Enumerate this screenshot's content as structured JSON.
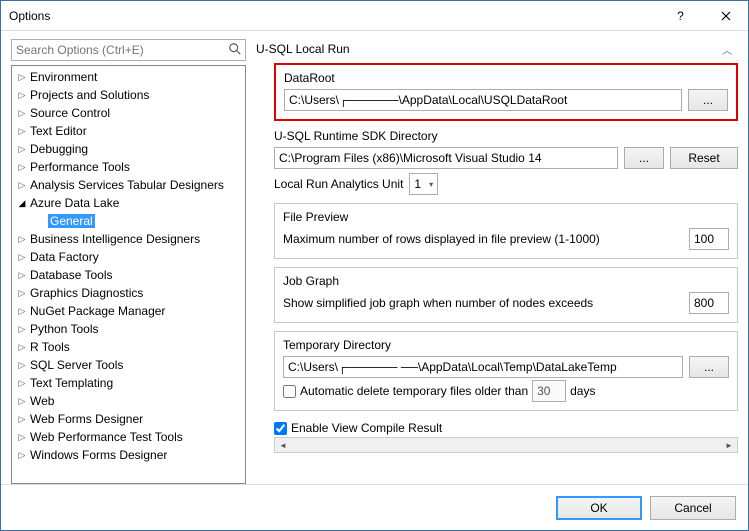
{
  "window": {
    "title": "Options"
  },
  "search": {
    "placeholder": "Search Options (Ctrl+E)"
  },
  "tree": {
    "items": [
      {
        "label": "Environment",
        "expanded": false,
        "indent": 0
      },
      {
        "label": "Projects and Solutions",
        "expanded": false,
        "indent": 0
      },
      {
        "label": "Source Control",
        "expanded": false,
        "indent": 0
      },
      {
        "label": "Text Editor",
        "expanded": false,
        "indent": 0
      },
      {
        "label": "Debugging",
        "expanded": false,
        "indent": 0
      },
      {
        "label": "Performance Tools",
        "expanded": false,
        "indent": 0
      },
      {
        "label": "Analysis Services Tabular Designers",
        "expanded": false,
        "indent": 0
      },
      {
        "label": "Azure Data Lake",
        "expanded": true,
        "indent": 0
      },
      {
        "label": "General",
        "expanded": null,
        "indent": 1,
        "selected": true
      },
      {
        "label": "Business Intelligence Designers",
        "expanded": false,
        "indent": 0
      },
      {
        "label": "Data Factory",
        "expanded": false,
        "indent": 0
      },
      {
        "label": "Database Tools",
        "expanded": false,
        "indent": 0
      },
      {
        "label": "Graphics Diagnostics",
        "expanded": false,
        "indent": 0
      },
      {
        "label": "NuGet Package Manager",
        "expanded": false,
        "indent": 0
      },
      {
        "label": "Python Tools",
        "expanded": false,
        "indent": 0
      },
      {
        "label": "R Tools",
        "expanded": false,
        "indent": 0
      },
      {
        "label": "SQL Server Tools",
        "expanded": false,
        "indent": 0
      },
      {
        "label": "Text Templating",
        "expanded": false,
        "indent": 0
      },
      {
        "label": "Web",
        "expanded": false,
        "indent": 0
      },
      {
        "label": "Web Forms Designer",
        "expanded": false,
        "indent": 0
      },
      {
        "label": "Web Performance Test Tools",
        "expanded": false,
        "indent": 0
      },
      {
        "label": "Windows Forms Designer",
        "expanded": false,
        "indent": 0
      }
    ]
  },
  "panel": {
    "header": "U-SQL Local Run",
    "dataroot": {
      "label": "DataRoot",
      "value": "C:\\Users\\┌──────\\AppData\\Local\\USQLDataRoot",
      "browse": "..."
    },
    "runtime": {
      "label": "U-SQL Runtime SDK Directory",
      "value": "C:\\Program Files (x86)\\Microsoft Visual Studio 14",
      "browse": "...",
      "reset": "Reset"
    },
    "analytics": {
      "label": "Local Run Analytics Unit",
      "value": "1"
    },
    "filepreview": {
      "label": "File Preview",
      "rows_label": "Maximum number of rows displayed in file preview (1-1000)",
      "rows_value": "100"
    },
    "jobgraph": {
      "label": "Job Graph",
      "text": "Show simplified job graph when number of nodes exceeds",
      "value": "800"
    },
    "tempdir": {
      "label": "Temporary Directory",
      "value": "C:\\Users\\┌────── ──\\AppData\\Local\\Temp\\DataLakeTemp",
      "browse": "...",
      "autodelete_label_pre": "Automatic delete temporary files older than",
      "autodelete_value": "30",
      "autodelete_label_post": "days",
      "autodelete_checked": false
    },
    "enable_compile": {
      "label": "Enable View Compile Result",
      "checked": true
    }
  },
  "footer": {
    "ok": "OK",
    "cancel": "Cancel"
  }
}
